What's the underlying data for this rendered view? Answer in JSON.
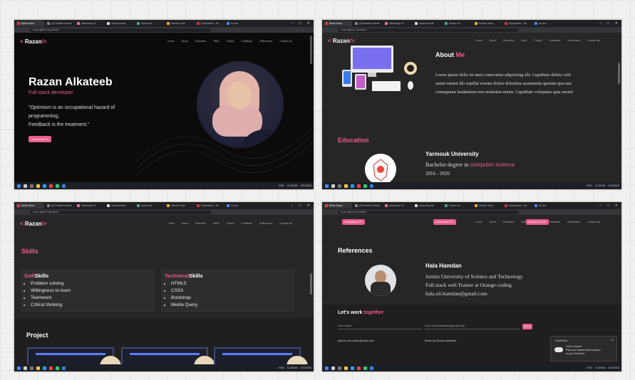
{
  "browser": {
    "tabs": [
      "Berlin Nova",
      "(9) Rewrite Donati",
      "Interstudy Ch",
      "razan Abouki",
      "Kondo Ich",
      "Kerene Yoon",
      "Exploration - De",
      "Ar-Aro"
    ],
    "url": "razan.github.io/portfolio"
  },
  "site": {
    "logo_open": "< ",
    "logo_name": "Razan",
    "logo_close": "/>",
    "menu": [
      "Home",
      "About",
      "Education",
      "Skills",
      "Project",
      "Certificate",
      "References",
      "Contact me"
    ]
  },
  "hero": {
    "name": "Razan Alkateeb",
    "role": "Full-stack developer",
    "quote_line1": "\"Optimism is an occupational hazard of",
    "quote_line2": "programming,",
    "quote_line3": "Feedback is the treatment.\"",
    "button": "Download CV"
  },
  "about": {
    "title_1": "About",
    "title_2": "Me",
    "text_1": "Lorem ipsum dolor sit amet consectetur adipisicing elit. Cupiditate debitis velit",
    "text_2": "animi tenetur illo repellat veniam dolore doloribus assumenda aperiam ipsa nisi",
    "text_3": "consequatur laudantium eius molestiae minus. Cupiditate voluptates quia earum!"
  },
  "education": {
    "title": "Education",
    "school": "Yarmouk University",
    "degree_1": "Bachelor degree in",
    "degree_2": "computer science",
    "years": "2016 - 2020"
  },
  "skills": {
    "title": "Skills",
    "soft_1": "Soft",
    "soft_2": "Skills",
    "soft_items": [
      "Problem solving",
      "Willingness to learn",
      "Teamwork",
      "Critical thinking"
    ],
    "tech_1": "Technical",
    "tech_2": "Skills",
    "tech_items": [
      "HTML5",
      "CSS3",
      "Bootstrap",
      "Media Query"
    ],
    "project_title": "Project"
  },
  "references": {
    "title": "References",
    "name": "Hala Hamdan",
    "line1": "Jordan University of Science and Technology",
    "line2": "Full stack web Trainer at Orange coding",
    "email": "hala.uli.hamdan@gmail.com"
  },
  "contact": {
    "title_1": "Let's work",
    "title_2": "together",
    "name_placeholder": "Your name",
    "email_placeholder": "Your email address@gmail.com",
    "send": "Send",
    "footer_left": "yahoo.com razan@mail.com",
    "footer_right": "Made by Razan Alkateeb"
  },
  "pink_btn": {
    "a": "Download CV",
    "b": "Download CV",
    "c": "Download CV"
  },
  "toast": {
    "title": "OneDrive",
    "line1": "A file is turned",
    "line2": "Files and folders will be synced",
    "line3": "to your OneDrive"
  },
  "taskbar": {
    "time": "11:38 AM",
    "date": "1/31/2023",
    "lang": "ENG"
  },
  "colors": {
    "accent": "#e85d8f",
    "background": "#262626"
  }
}
